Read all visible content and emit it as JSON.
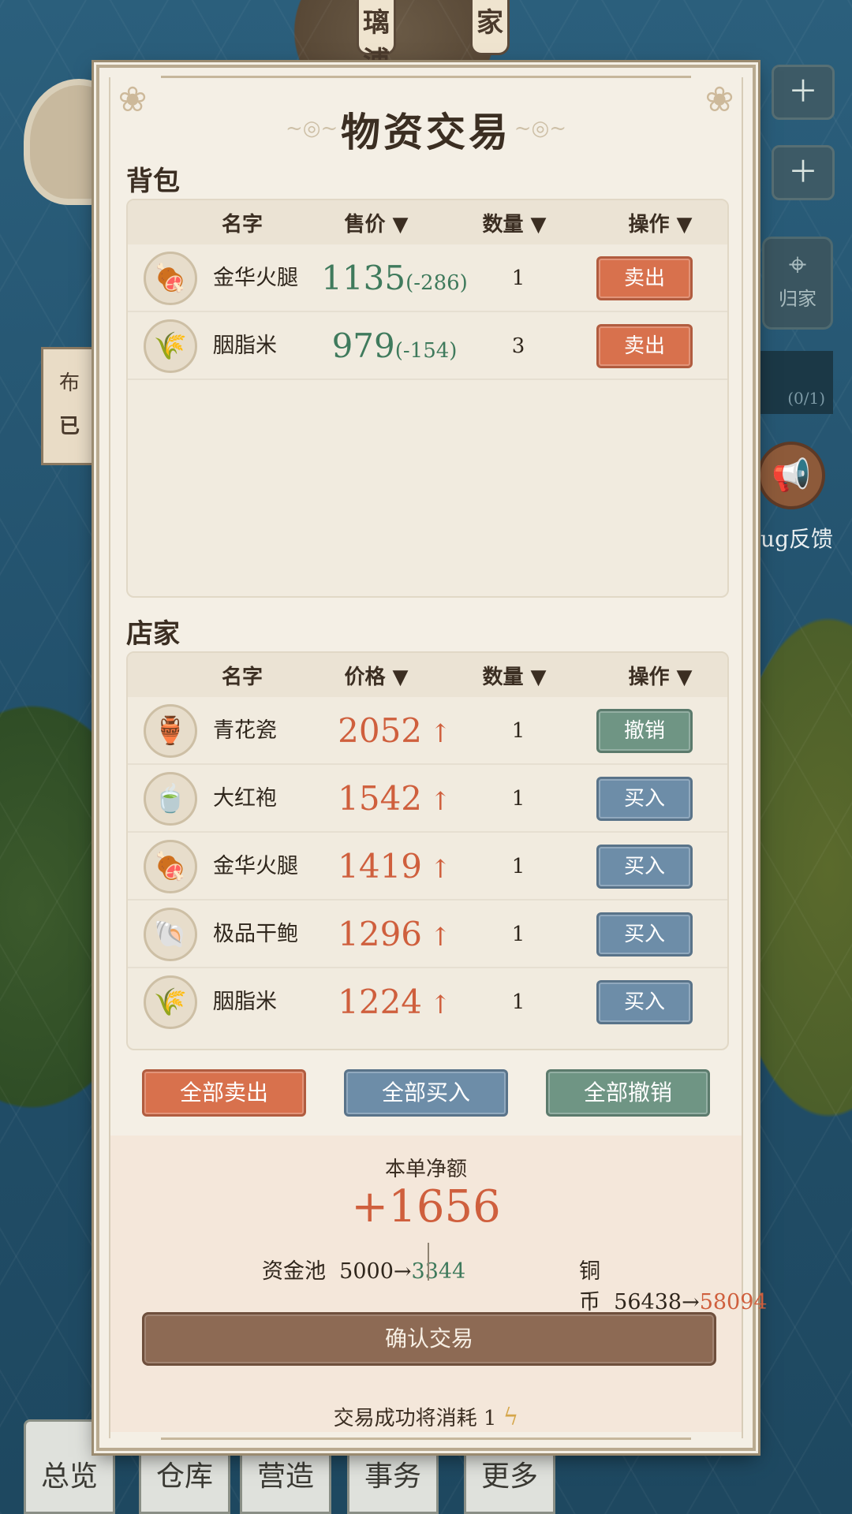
{
  "background": {
    "top_tabs": [
      "璃浦",
      "家"
    ],
    "home_label": "归家",
    "progress_text": "(0/1)",
    "feedback_label": "ug反馈",
    "left_card_lines": [
      "布",
      "已"
    ],
    "bottom_tabs": [
      "总览",
      "仓库",
      "营造",
      "事务",
      "更多"
    ]
  },
  "modal": {
    "title": "物资交易",
    "backpack": {
      "label": "背包",
      "headers": {
        "name": "名字",
        "price": "售价 ▼",
        "qty": "数量 ▼",
        "op": "操作 ▼"
      },
      "rows": [
        {
          "icon": "ham-box-icon",
          "glyph": "🍖",
          "name": "金华火腿",
          "price": "1135",
          "delta": "(-286)",
          "qty": "1",
          "action": "卖出"
        },
        {
          "icon": "rice-sack-icon",
          "glyph": "🌾",
          "name": "胭脂米",
          "price": "979",
          "delta": "(-154)",
          "qty": "3",
          "action": "卖出"
        }
      ]
    },
    "shop": {
      "label": "店家",
      "headers": {
        "name": "名字",
        "price": "价格 ▼",
        "qty": "数量 ▼",
        "op": "操作 ▼"
      },
      "rows": [
        {
          "icon": "porcelain-vase-icon",
          "glyph": "🏺",
          "name": "青花瓷",
          "price": "2052",
          "arrow": "↑",
          "qty": "1",
          "action": "撤销",
          "kind": "cancel"
        },
        {
          "icon": "tea-jar-icon",
          "glyph": "🍵",
          "name": "大红袍",
          "price": "1542",
          "arrow": "↑",
          "qty": "1",
          "action": "买入",
          "kind": "buy"
        },
        {
          "icon": "ham-box-icon",
          "glyph": "🍖",
          "name": "金华火腿",
          "price": "1419",
          "arrow": "↑",
          "qty": "1",
          "action": "买入",
          "kind": "buy"
        },
        {
          "icon": "abalone-box-icon",
          "glyph": "🐚",
          "name": "极品干鲍",
          "price": "1296",
          "arrow": "↑",
          "qty": "1",
          "action": "买入",
          "kind": "buy"
        },
        {
          "icon": "rice-sack-icon",
          "glyph": "🌾",
          "name": "胭脂米",
          "price": "1224",
          "arrow": "↑",
          "qty": "1",
          "action": "买入",
          "kind": "buy"
        }
      ]
    },
    "bulk": {
      "sell_all": "全部卖出",
      "buy_all": "全部买入",
      "cancel_all": "全部撤销"
    },
    "summary": {
      "net_label": "本单净额",
      "net_value": "+1656",
      "fund_label": "资金池",
      "fund_from": "5000→",
      "fund_to": "3344",
      "coin_label": "铜币",
      "coin_from": "56438→",
      "coin_to": "58094",
      "confirm": "确认交易",
      "cost_note": "交易成功将消耗 1"
    },
    "colors": {
      "sell": "#d8714d",
      "buy": "#6d8da8",
      "cancel": "#6f9584",
      "confirm": "#8d6a54",
      "gain_green": "#3f7a5c",
      "price_red": "#cf5f3d"
    }
  }
}
